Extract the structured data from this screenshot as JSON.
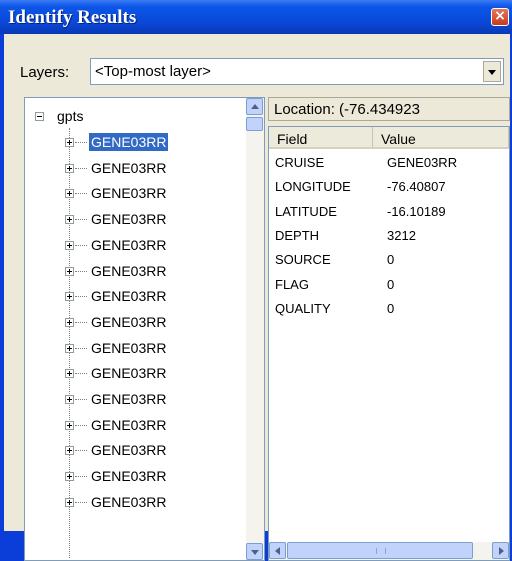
{
  "window": {
    "title": "Identify Results",
    "close_glyph": "×"
  },
  "layers": {
    "label": "Layers:",
    "value": "<Top-most layer>"
  },
  "tree": {
    "root_label": "gpts",
    "items": [
      {
        "label": "GENE03RR",
        "selected": true
      },
      {
        "label": "GENE03RR"
      },
      {
        "label": "GENE03RR"
      },
      {
        "label": "GENE03RR"
      },
      {
        "label": "GENE03RR"
      },
      {
        "label": "GENE03RR"
      },
      {
        "label": "GENE03RR"
      },
      {
        "label": "GENE03RR"
      },
      {
        "label": "GENE03RR"
      },
      {
        "label": "GENE03RR"
      },
      {
        "label": "GENE03RR"
      },
      {
        "label": "GENE03RR"
      },
      {
        "label": "GENE03RR"
      },
      {
        "label": "GENE03RR"
      },
      {
        "label": "GENE03RR"
      }
    ]
  },
  "location": {
    "text": "Location: (-76.434923"
  },
  "attributes": {
    "headers": {
      "field": "Field",
      "value": "Value"
    },
    "rows": [
      {
        "field": "CRUISE",
        "value": "GENE03RR"
      },
      {
        "field": "LONGITUDE",
        "value": "-76.40807"
      },
      {
        "field": "LATITUDE",
        "value": "-16.10189"
      },
      {
        "field": "DEPTH",
        "value": "3212"
      },
      {
        "field": "SOURCE",
        "value": "0"
      },
      {
        "field": "FLAG",
        "value": "0"
      },
      {
        "field": "QUALITY",
        "value": "0"
      }
    ]
  },
  "icons": {
    "close": "close-icon",
    "dropdown": "chevron-down-icon",
    "collapse": "minus-box-icon",
    "expand": "plus-box-icon"
  },
  "colors": {
    "titlebar": "#0a47d6",
    "selection": "#316ac5",
    "dialog_face": "#ece9d8",
    "close_button": "#c73a1e"
  }
}
